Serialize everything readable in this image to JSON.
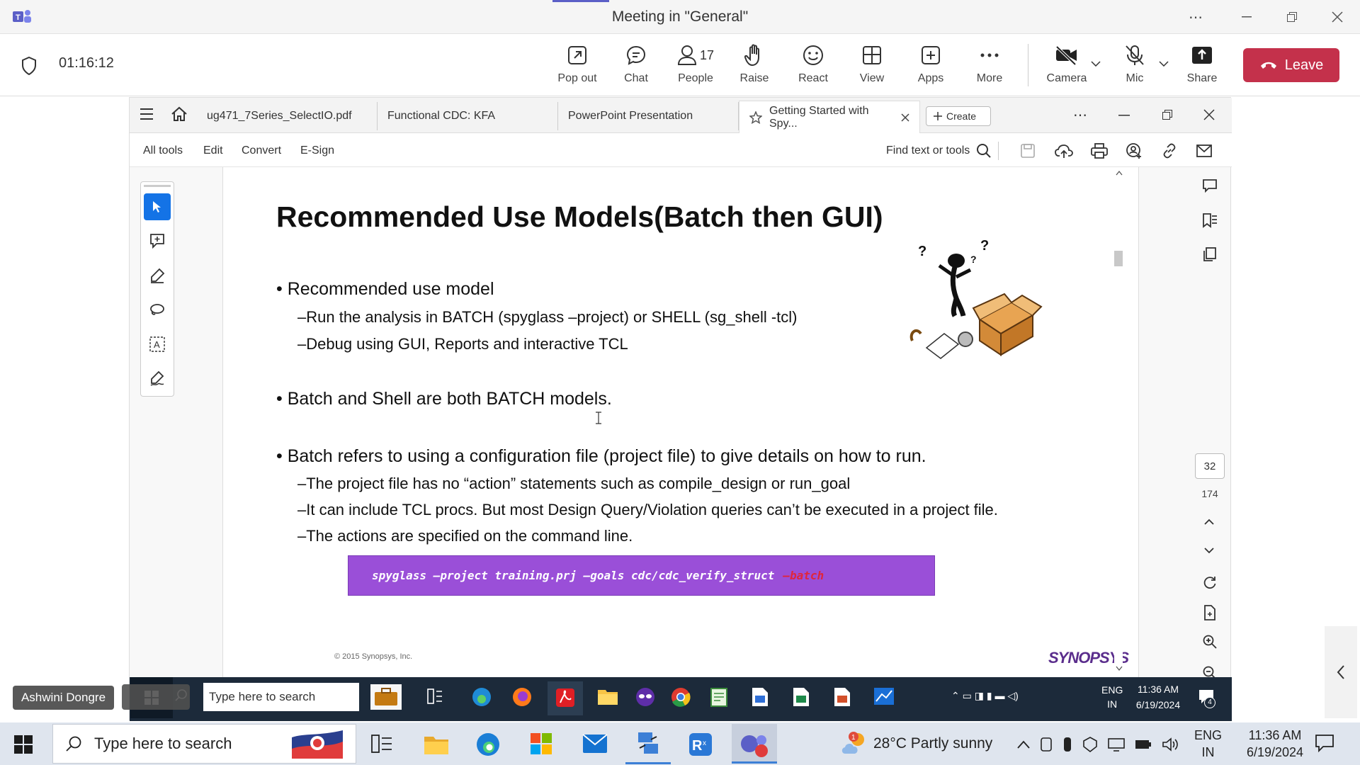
{
  "titlebar": {
    "title": "Meeting in \"General\"",
    "icons": [
      "teams-logo-icon",
      "more-icon",
      "minimize-icon",
      "restore-icon",
      "close-icon"
    ]
  },
  "meeting": {
    "timer": "01:16:12",
    "buttons": {
      "popout": "Pop out",
      "chat": "Chat",
      "people": "People",
      "people_count": "17",
      "raise": "Raise",
      "react": "React",
      "view": "View",
      "apps": "Apps",
      "more": "More",
      "camera": "Camera",
      "mic": "Mic",
      "share": "Share",
      "leave": "Leave"
    }
  },
  "acrobat": {
    "tabs": [
      "ug471_7Series_SelectIO.pdf",
      "Functional CDC: KFA",
      "PowerPoint Presentation",
      "Getting Started with Spy..."
    ],
    "create": "Create",
    "menu": [
      "All tools",
      "Edit",
      "Convert",
      "E-Sign"
    ],
    "find": "Find text or tools",
    "page_current": "32",
    "page_total": "174"
  },
  "slide": {
    "title": "Recommended Use Models(Batch then GUI)",
    "bullets": [
      {
        "level": 1,
        "text": "• Recommended use model"
      },
      {
        "level": 2,
        "text": "–Run the analysis in BATCH (spyglass –project) or SHELL (sg_shell -tcl)"
      },
      {
        "level": 2,
        "text": "–Debug using GUI, Reports and interactive TCL"
      },
      {
        "level": 1,
        "text": "• Batch and Shell are both BATCH models."
      },
      {
        "level": 1,
        "text": "• Batch refers to using a configuration file (project file) to give details on how to run."
      },
      {
        "level": 2,
        "text": "–The project file has no “action” statements such as compile_design or run_goal"
      },
      {
        "level": 2,
        "text": "–It can include TCL procs. But most Design Query/Violation queries can’t be executed in a project file."
      },
      {
        "level": 2,
        "text": "–The actions are specified on the command line."
      }
    ],
    "command": "spyglass –project training.prj –goals cdc/cdc_verify_struct",
    "command_flag": "–batch",
    "copyright": "© 2015 Synopsys, Inc.",
    "logo": "SYNOPSYS"
  },
  "presenter": "Ashwini Dongre",
  "inner_taskbar": {
    "search": "Type here to search",
    "lang": "ENG",
    "region": "IN",
    "time": "11:36 AM",
    "date": "6/19/2024",
    "badge": "4"
  },
  "taskbar": {
    "search": "Type here to search",
    "weather": "28°C  Partly sunny",
    "lang": "ENG",
    "region": "IN",
    "time": "11:36 AM",
    "date": "6/19/2024"
  }
}
